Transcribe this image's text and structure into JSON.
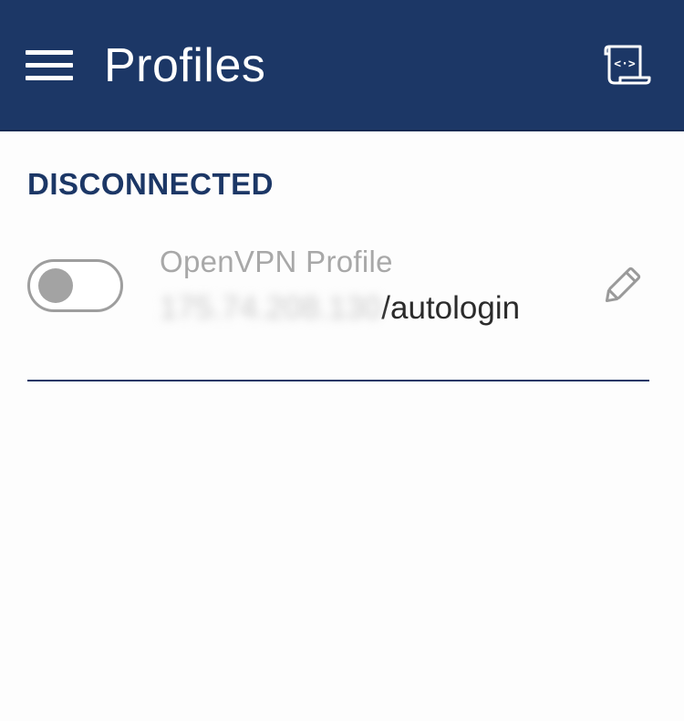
{
  "app_bar": {
    "title": "Profiles",
    "menu_icon": "hamburger-menu-icon",
    "action_icon": "log-scroll-icon",
    "color": "#1c3766"
  },
  "section": {
    "header": "DISCONNECTED"
  },
  "profile": {
    "name": "OpenVPN Profile",
    "host_redacted": "175.74.208.130",
    "host_suffix": "/autologin",
    "connected": false,
    "edit_icon": "pencil-icon"
  }
}
